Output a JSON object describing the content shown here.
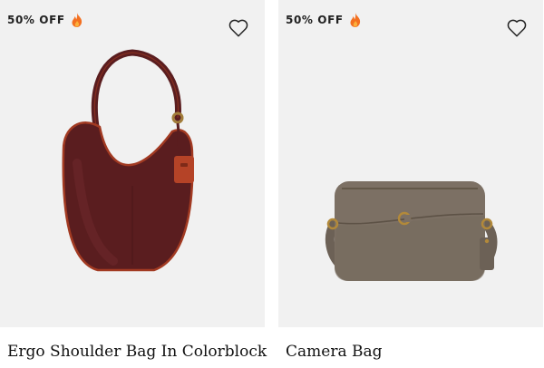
{
  "products": [
    {
      "badge": "50% OFF",
      "badge_icon": "fire-icon",
      "title": "Ergo Shoulder Bag In Colorblock",
      "wishlist_icon": "heart-outline-icon",
      "colors": {
        "bag": "#5a1d1f",
        "trim": "#a23a22",
        "hardware": "#a27d3a"
      }
    },
    {
      "badge": "50% OFF",
      "badge_icon": "fire-icon",
      "title": "Camera Bag",
      "wishlist_icon": "heart-outline-icon",
      "colors": {
        "bag": "#7c7064",
        "strap": "#6c6156",
        "hardware": "#b2893a"
      }
    }
  ]
}
